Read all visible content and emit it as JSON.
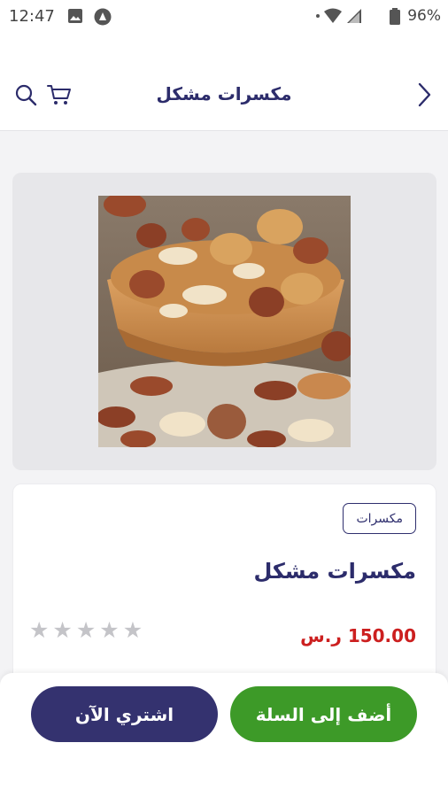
{
  "status_bar": {
    "time": "12:47",
    "battery": "96%"
  },
  "header": {
    "title": "مكسرات مشكل",
    "icons": [
      "search-icon",
      "cart-icon",
      "chevron-right-icon"
    ]
  },
  "product": {
    "category": "مكسرات",
    "name": "مكسرات مشكل",
    "price": "150.00 ر.س",
    "rating_stars": 5,
    "rating_value": 0,
    "image": "mixed-nuts-bowl"
  },
  "actions": {
    "add_to_cart": "أضف إلى السلة",
    "buy_now": "اشتري الآن"
  },
  "colors": {
    "primary": "#34326f",
    "cart_button": "#3d9a28",
    "price": "#cc1f1f",
    "star_empty": "#c4c4c8"
  }
}
